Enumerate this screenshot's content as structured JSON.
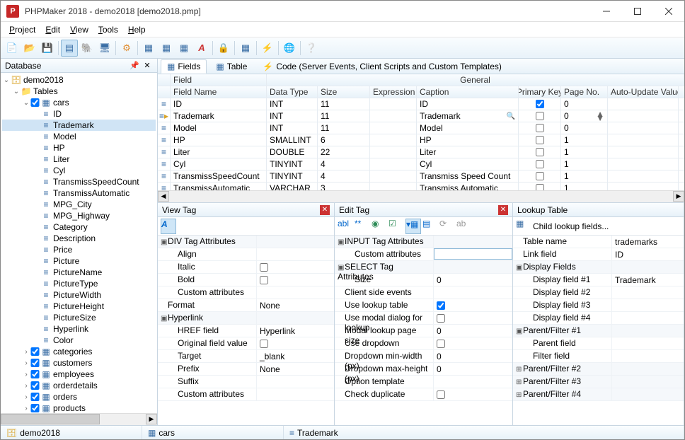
{
  "window": {
    "title": "PHPMaker 2018 - demo2018 [demo2018.pmp]",
    "app_icon_letter": "P"
  },
  "menu": {
    "items": [
      "Project",
      "Edit",
      "View",
      "Tools",
      "Help"
    ]
  },
  "left": {
    "header": "Database",
    "root": "demo2018",
    "tables_label": "Tables",
    "cars": {
      "name": "cars",
      "fields": [
        "ID",
        "Trademark",
        "Model",
        "HP",
        "Liter",
        "Cyl",
        "TransmissSpeedCount",
        "TransmissAutomatic",
        "MPG_City",
        "MPG_Highway",
        "Category",
        "Description",
        "Price",
        "Picture",
        "PictureName",
        "PictureType",
        "PictureWidth",
        "PictureHeight",
        "PictureSize",
        "Hyperlink",
        "Color"
      ]
    },
    "other_tables": [
      "categories",
      "customers",
      "employees",
      "orderdetails",
      "orders",
      "products"
    ]
  },
  "tabs": {
    "fields": "Fields",
    "table": "Table",
    "code": "Code (Server Events, Client Scripts and Custom Templates)"
  },
  "grid": {
    "super_field": "Field",
    "super_general": "General",
    "cols": {
      "fieldname": "Field Name",
      "datatype": "Data Type",
      "size": "Size",
      "expr": "Expression",
      "caption": "Caption",
      "pk": "Primary Key",
      "pageno": "Page No.",
      "auto": "Auto-Update Value"
    },
    "rows": [
      {
        "fn": "ID",
        "dt": "INT",
        "size": "11",
        "cap": "ID",
        "pk": true,
        "pg": "0"
      },
      {
        "fn": "Trademark",
        "dt": "INT",
        "size": "11",
        "cap": "Trademark",
        "pk": false,
        "pg": "0",
        "active": true,
        "lookup_icon": true
      },
      {
        "fn": "Model",
        "dt": "INT",
        "size": "11",
        "cap": "Model",
        "pk": false,
        "pg": "0"
      },
      {
        "fn": "HP",
        "dt": "SMALLINT",
        "size": "6",
        "cap": "HP",
        "pk": false,
        "pg": "1"
      },
      {
        "fn": "Liter",
        "dt": "DOUBLE",
        "size": "22",
        "cap": "Liter",
        "pk": false,
        "pg": "1"
      },
      {
        "fn": "Cyl",
        "dt": "TINYINT",
        "size": "4",
        "cap": "Cyl",
        "pk": false,
        "pg": "1"
      },
      {
        "fn": "TransmissSpeedCount",
        "dt": "TINYINT",
        "size": "4",
        "cap": "Transmiss Speed Count",
        "pk": false,
        "pg": "1"
      },
      {
        "fn": "TransmissAutomatic",
        "dt": "VARCHAR",
        "size": "3",
        "cap": "Transmiss Automatic",
        "pk": false,
        "pg": "1"
      }
    ]
  },
  "viewtag": {
    "title": "View Tag",
    "section1": "DIV Tag Attributes",
    "align": "Align",
    "italic": "Italic",
    "bold": "Bold",
    "custom": "Custom attributes",
    "format_label": "Format",
    "format_val": "None",
    "section2": "Hyperlink",
    "href": "HREF field",
    "href_val": "Hyperlink",
    "orig": "Original field value",
    "target": "Target",
    "target_val": "_blank",
    "prefix": "Prefix",
    "prefix_val": "None",
    "suffix": "Suffix",
    "custom2": "Custom attributes"
  },
  "edittag": {
    "title": "Edit Tag",
    "section1": "INPUT Tag Attributes",
    "custom": "Custom attributes",
    "section2": "SELECT Tag Attributes",
    "size": "Size",
    "size_val": "0",
    "cse": "Client side events",
    "ult": "Use lookup table",
    "ult_val": true,
    "modal": "Use modal dialog for lookup",
    "mps": "Modal lookup page size",
    "mps_val": "0",
    "udd": "Use dropdown",
    "ddmin": "Dropdown min-width (px)",
    "ddmin_val": "0",
    "ddmax": "Dropdown max-height (px)",
    "ddmax_val": "0",
    "opt": "Option template",
    "cdup": "Check duplicate"
  },
  "lookup": {
    "title": "Lookup Table",
    "child": "Child lookup fields...",
    "tname": "Table name",
    "tname_val": "trademarks",
    "lfield": "Link field",
    "lfield_val": "ID",
    "section_df": "Display Fields",
    "df1": "Display field #1",
    "df1_val": "Trademark",
    "df2": "Display field #2",
    "df3": "Display field #3",
    "df4": "Display field #4",
    "section_pf1": "Parent/Filter #1",
    "pfield": "Parent field",
    "ffield": "Filter field",
    "section_pf2": "Parent/Filter #2",
    "section_pf3": "Parent/Filter #3",
    "section_pf4": "Parent/Filter #4"
  },
  "status": {
    "project": "demo2018",
    "table": "cars",
    "field": "Trademark"
  }
}
